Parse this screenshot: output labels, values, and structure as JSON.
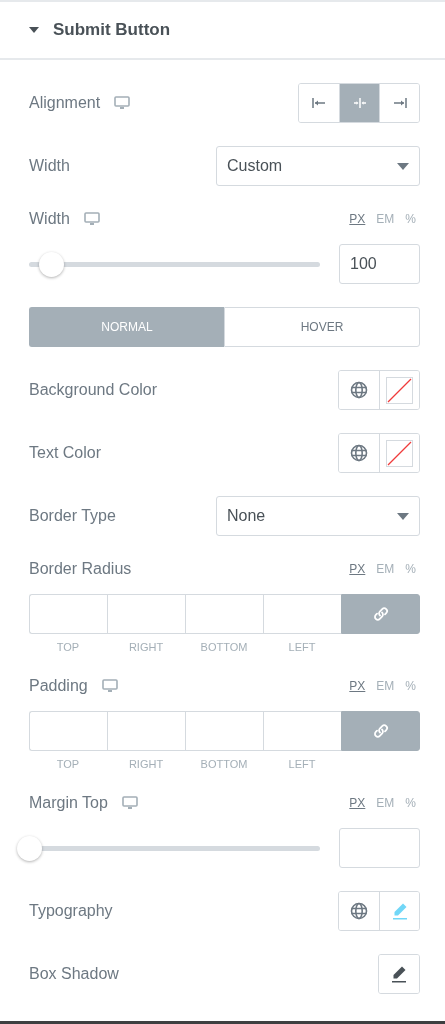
{
  "section": {
    "title": "Submit Button",
    "expanded": true
  },
  "controls": [
    {
      "kind": "choose",
      "label": "Alignment",
      "responsive": true,
      "options": [
        {
          "selected": false
        },
        {
          "selected": true
        },
        {
          "selected": false
        }
      ]
    },
    {
      "kind": "select",
      "label": "Width",
      "value": "Custom"
    },
    {
      "kind": "slider",
      "label": "Width",
      "responsive": true,
      "units": [
        {
          "label": "PX",
          "selected": true
        },
        {
          "label": "EM",
          "selected": false
        },
        {
          "label": "%",
          "selected": false
        }
      ],
      "level": 0.08,
      "value": "100"
    },
    {
      "kind": "tabs",
      "tabs": [
        {
          "label": "NORMAL",
          "selected": true
        },
        {
          "label": "HOVER",
          "selected": false
        }
      ]
    },
    {
      "kind": "color",
      "label": "Background Color"
    },
    {
      "kind": "color",
      "label": "Text Color"
    },
    {
      "kind": "select",
      "label": "Border Type",
      "value": "None"
    },
    {
      "kind": "dimensions",
      "label": "Border Radius",
      "responsive": false,
      "units": [
        {
          "label": "PX",
          "selected": true
        },
        {
          "label": "EM",
          "selected": false
        },
        {
          "label": "%",
          "selected": false
        }
      ],
      "linked": true,
      "sides": [
        "TOP",
        "RIGHT",
        "BOTTOM",
        "LEFT"
      ]
    },
    {
      "kind": "dimensions",
      "label": "Padding",
      "responsive": true,
      "units": [
        {
          "label": "PX",
          "selected": true
        },
        {
          "label": "EM",
          "selected": false
        },
        {
          "label": "%",
          "selected": false
        }
      ],
      "linked": true,
      "sides": [
        "TOP",
        "RIGHT",
        "BOTTOM",
        "LEFT"
      ]
    },
    {
      "kind": "slider",
      "label": "Margin Top",
      "responsive": true,
      "units": [
        {
          "label": "PX",
          "selected": true
        },
        {
          "label": "EM",
          "selected": false
        },
        {
          "label": "%",
          "selected": false
        }
      ],
      "level": 0
    },
    {
      "kind": "popover",
      "label": "Typography",
      "global": true,
      "active": true
    },
    {
      "kind": "popover",
      "label": "Box Shadow",
      "global": false,
      "active": false
    }
  ]
}
